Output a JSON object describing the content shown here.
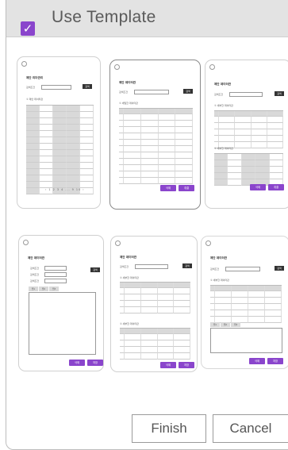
{
  "dialog": {
    "title": "Use Template",
    "checked": true
  },
  "templates": [
    {
      "name": "template-1",
      "title": "제안 리더관리",
      "section": "① 제안 데이터관",
      "pager": "‹ 1 2 3 4 ... 9 10 ›"
    },
    {
      "name": "template-2",
      "title": "제안 데이터관",
      "section": "① 세밀한 데이터관",
      "buttons": [
        "삭제",
        "취결"
      ]
    },
    {
      "name": "template-3",
      "title": "제안 데이터관",
      "section": "① 세부한 데이터관",
      "section2": "① 세부한 데이터관",
      "buttons": [
        "삭제",
        "취결"
      ]
    },
    {
      "name": "template-4",
      "title": "제안 데이터관",
      "tabs": [
        "탭1",
        "탭2",
        "탭3"
      ],
      "buttons": [
        "삭제",
        "저장"
      ]
    },
    {
      "name": "template-5",
      "title": "제안 데이터관",
      "section": "① 세부한 데이터관",
      "section2": "① 세부한 데이터관",
      "buttons": [
        "삭제",
        "저장"
      ]
    },
    {
      "name": "template-6",
      "title": "제안 데이터관",
      "section": "① 세부한 데이터관",
      "tabs": [
        "탭1",
        "탭2",
        "탭3"
      ],
      "buttons": [
        "삭제",
        "저장"
      ]
    }
  ],
  "mini": {
    "search_label": "검색조건",
    "search_btn": "검색"
  },
  "footer": {
    "finish": "Finish",
    "cancel": "Cancel"
  },
  "colors": {
    "accent": "#8a45cc",
    "header_bg": "#e3e3e3"
  }
}
